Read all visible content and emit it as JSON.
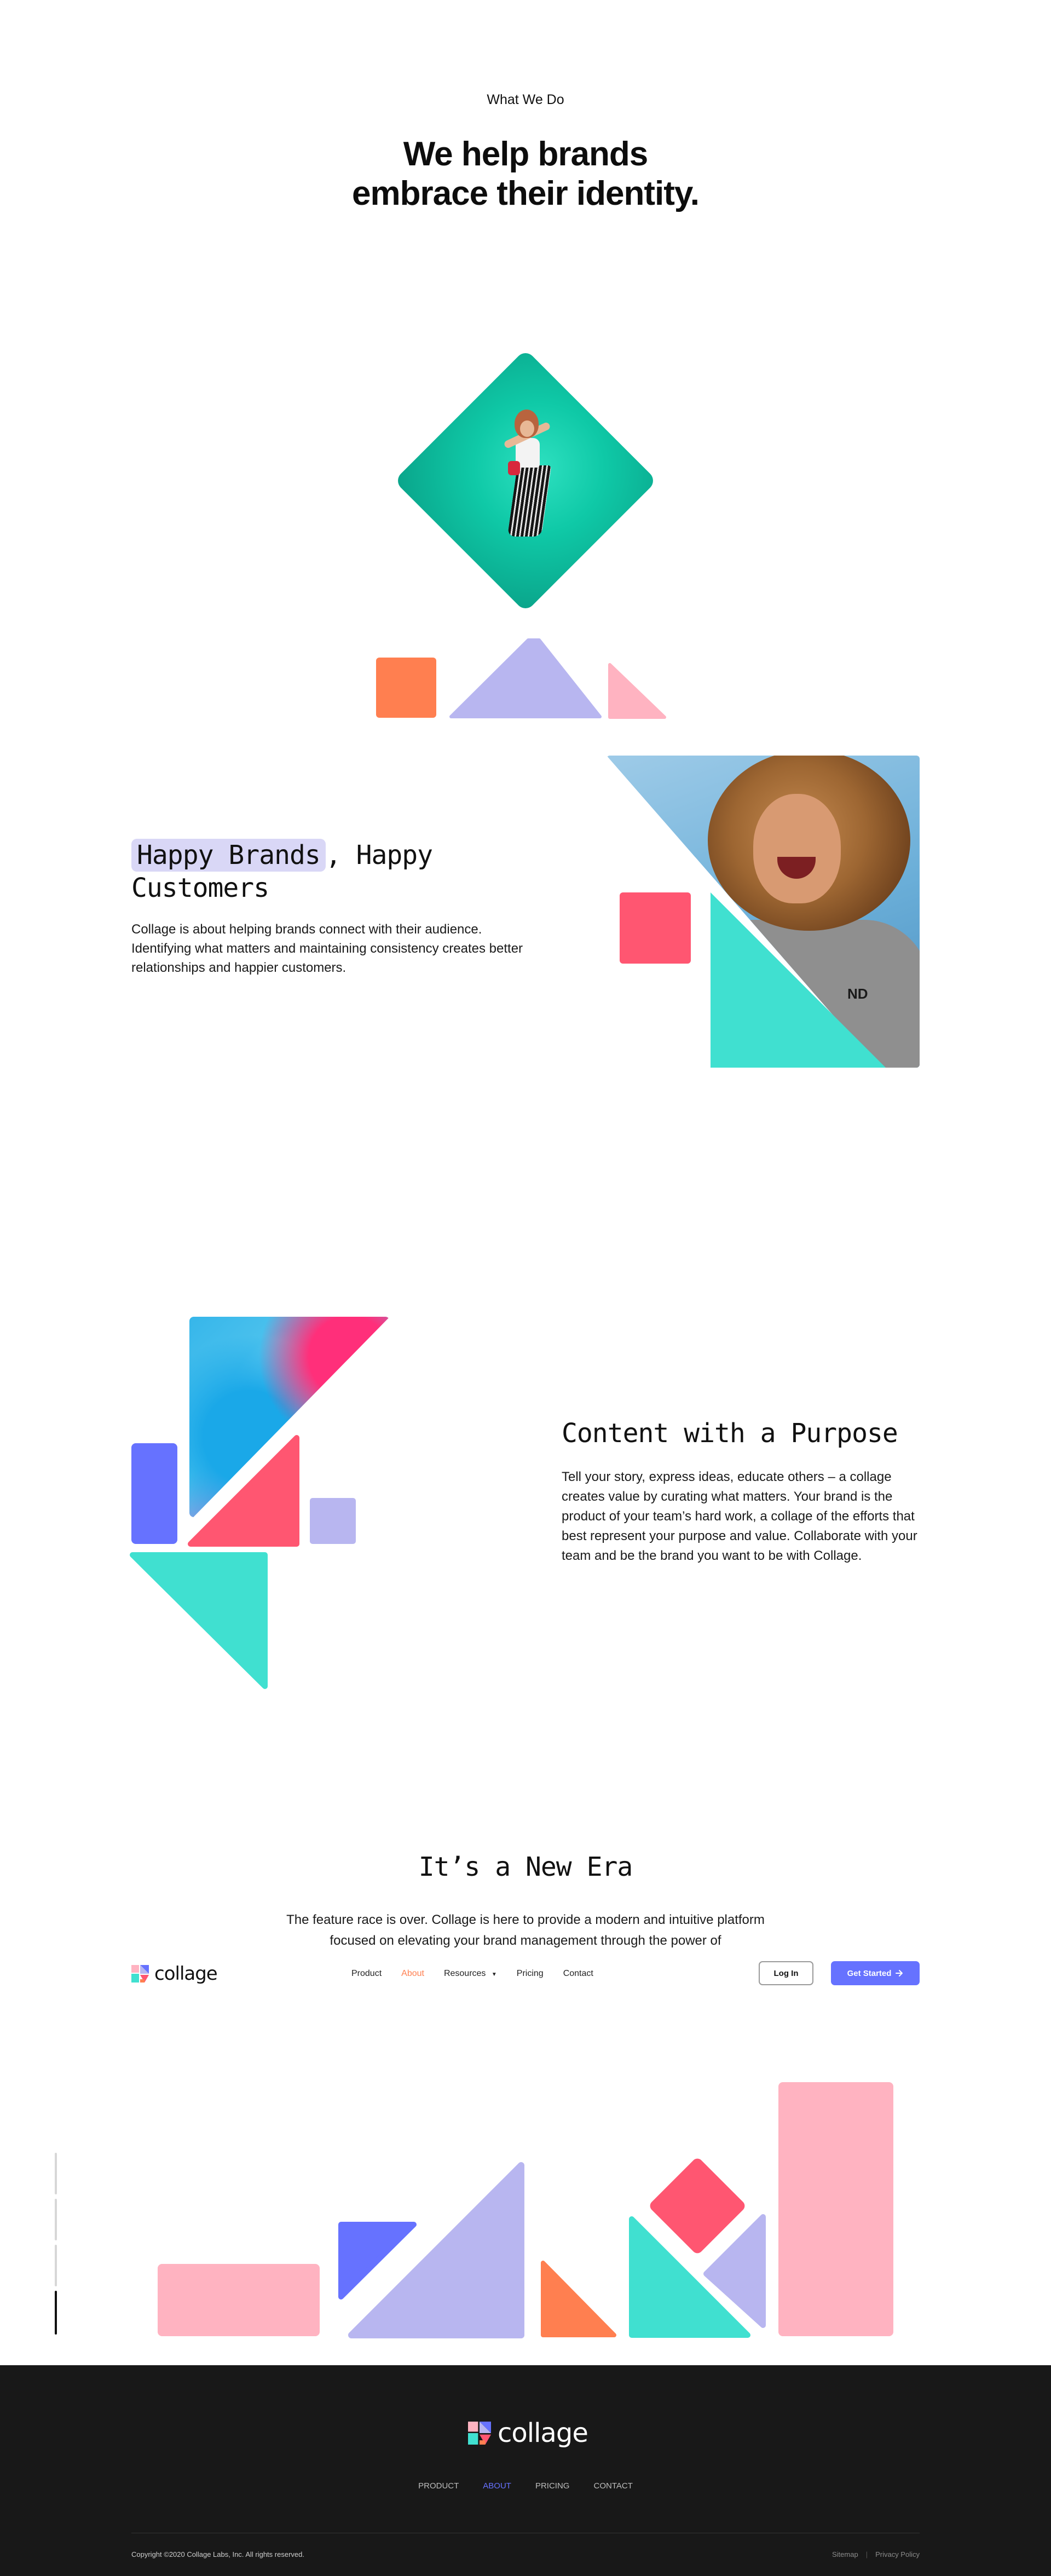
{
  "hero": {
    "eyebrow": "What We Do",
    "title_line1": "We help brands",
    "title_line2": "embrace their identity."
  },
  "happy_brands": {
    "title_highlight": "Happy Brands",
    "title_rest": ", Happy",
    "title_line2": "Customers",
    "body": "Collage is about helping brands connect with their audience. Identifying what matters and maintaining consistency creates better relationships and happier customers.",
    "photo_shirt_text": "ND"
  },
  "content_purpose": {
    "title": "Content with a Purpose",
    "body": "Tell your story, express ideas, educate others – a collage creates value by curating what matters. Your brand is the product of your team’s hard work, a collage of the efforts that best represent your purpose and value. Collaborate with your team and be the brand you want to be with Collage."
  },
  "new_era": {
    "title": "It’s a New Era",
    "body": "The feature race is over. Collage is here to provide a modern and intuitive platform focused on elevating your brand management through the power of"
  },
  "nav": {
    "logo_text": "collage",
    "links": [
      "Product",
      "About",
      "Resources",
      "Pricing",
      "Contact"
    ],
    "active_link": "About",
    "login_label": "Log In",
    "cta_label": "Get Started"
  },
  "footer": {
    "logo_text": "collage",
    "links": [
      "PRODUCT",
      "ABOUT",
      "PRICING",
      "CONTACT"
    ],
    "active_link": "ABOUT",
    "copyright": "Copyright ©2020 Collage Labs, Inc. All rights reserved.",
    "sitemap": "Sitemap",
    "separator": "|",
    "privacy": "Privacy Policy"
  },
  "scroll_indicator": {
    "count": 4,
    "active_index": 3
  },
  "colors": {
    "orange": "#ff7f50",
    "lavender": "#b8b6f0",
    "pink": "#ffb3c1",
    "coral_red": "#ff5671",
    "teal": "#40e0d0",
    "blue": "#6672ff",
    "footer_bg": "#181818",
    "highlight": "#d9d7f6"
  }
}
